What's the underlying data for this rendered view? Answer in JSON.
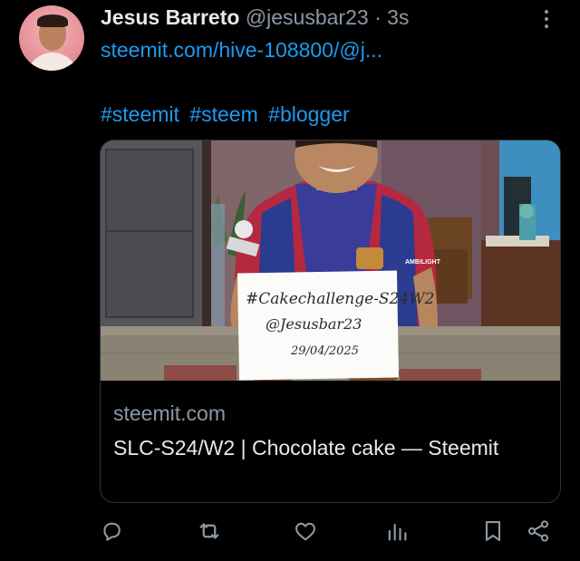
{
  "author": {
    "name": "Jesus Barreto",
    "handle": "@jesusbar23",
    "separator": "·",
    "time": "3s"
  },
  "tweet": {
    "link": "steemit.com/hive-108800/@j...",
    "hashtags": [
      "#steemit",
      "#steem",
      "#blogger"
    ]
  },
  "card": {
    "image": {
      "sign_lines": [
        "#Cakechallenge-S24W2",
        "@Jesusbar23",
        "29/04/2025"
      ],
      "shirt_text": "AMBILIGHT"
    },
    "domain": "steemit.com",
    "title": "SLC-S24/W2 | Chocolate cake — Steemit"
  },
  "icons": {
    "more": "more-options-icon",
    "reply": "reply-icon",
    "retweet": "retweet-icon",
    "like": "like-icon",
    "views": "views-icon",
    "bookmark": "bookmark-icon",
    "share": "share-icon"
  },
  "colors": {
    "background": "#000000",
    "text": "#e7e9ea",
    "secondary": "#8b98a5",
    "link": "#1d9bf0",
    "border": "#2f3336"
  }
}
